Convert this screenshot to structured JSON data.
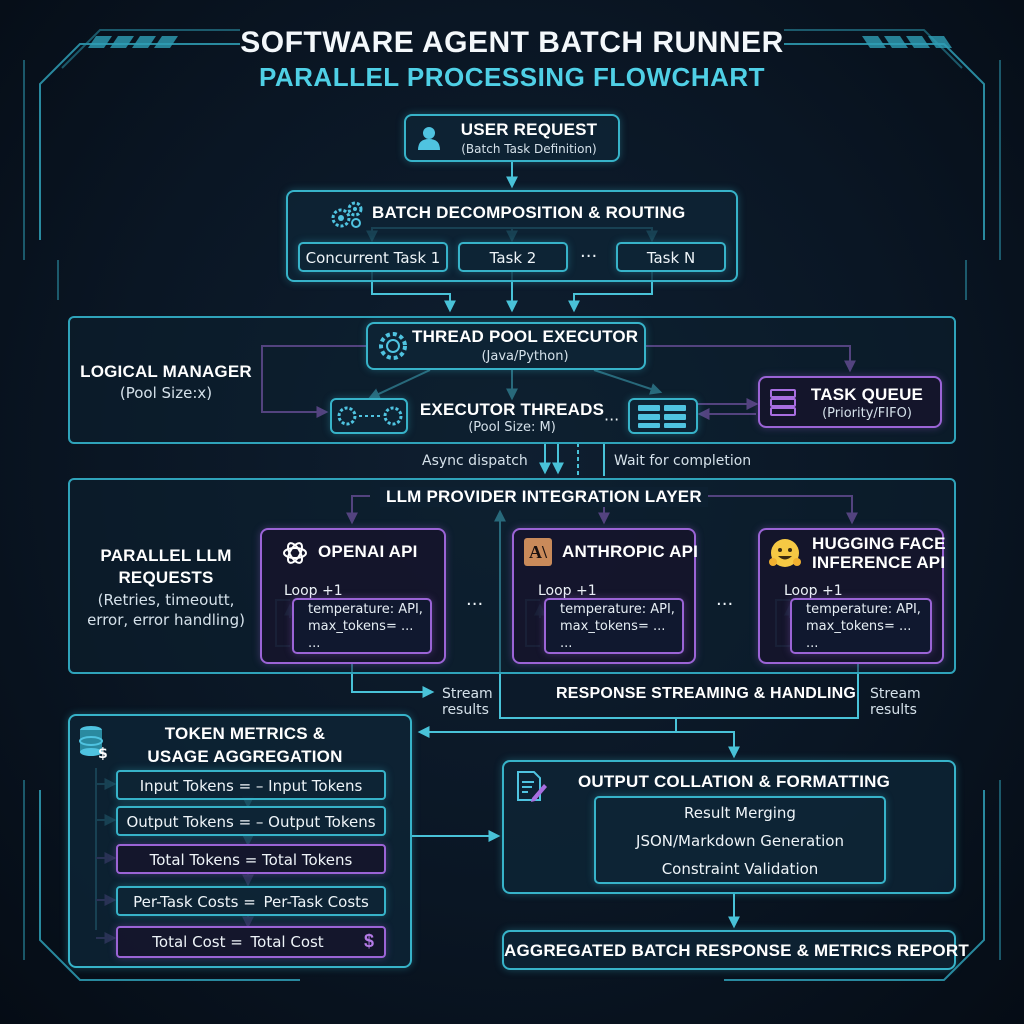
{
  "header": {
    "title": "SOFTWARE AGENT BATCH RUNNER",
    "subtitle": "PARALLEL PROCESSING FLOWCHART"
  },
  "user_request": {
    "title": "USER REQUEST",
    "sub": "(Batch Task Definition)",
    "icon": "user-icon"
  },
  "batch": {
    "title": "BATCH DECOMPOSITION & ROUTING",
    "icon": "gears-icon",
    "tasks": [
      "Concurrent Task 1",
      "Task 2",
      "Task N"
    ],
    "ellipsis": "···"
  },
  "manager": {
    "label": "LOGICAL MANAGER",
    "pool": "(Pool Size:x)",
    "executor_title": "THREAD POOL EXECUTOR",
    "executor_sub": "(Java/Python)",
    "threads_title": "EXECUTOR THREADS",
    "threads_sub": "(Pool Size: M)",
    "threads_ellipsis": "···",
    "queue_title": "TASK QUEUE",
    "queue_sub": "(Priority/FIFO)",
    "async_label": "Async dispatch",
    "wait_label": "Wait for completion"
  },
  "llm": {
    "layer_title": "LLM PROVIDER INTEGRATION LAYER",
    "left_title": "PARALLEL LLM\nREQUESTS",
    "left_sub": "(Retries, timeoutt,\nerror, error handling)",
    "ellipsis": "···",
    "providers": [
      {
        "name": "OPENAI API",
        "icon": "openai-icon",
        "loop": "Loop +1",
        "code": "temperature: API,\nmax_tokens= ...\n..."
      },
      {
        "name": "ANTHROPIC API",
        "icon": "anthropic-icon",
        "icon_text": "A\\",
        "loop": "Loop +1",
        "code": "temperature: API,\nmax_tokens= ...\n..."
      },
      {
        "name": "HUGGING FACE\nINFERENCE API",
        "icon": "hugging-face-icon",
        "loop": "Loop +1",
        "code": "temperature: API,\nmax_tokens= ...\n..."
      }
    ],
    "stream_left": "Stream\nresults",
    "stream_right": "Stream\nresults",
    "response_title": "RESPONSE STREAMING & HANDLING"
  },
  "metrics": {
    "title": "TOKEN METRICS &\nUSAGE AGGREGATION",
    "icon": "database-dollar-icon",
    "rows": [
      "Input Tokens = – Input Tokens",
      "Output Tokens = – Output Tokens",
      "Total Tokens = Total Tokens",
      "Per-Task Costs =  Per-Task Costs",
      "Total Cost =  Total Cost"
    ],
    "cost_symbol": "$"
  },
  "output": {
    "title": "OUTPUT COLLATION & FORMATTING",
    "icon": "document-edit-icon",
    "items": [
      "Result Merging",
      "JSON/Markdown Generation",
      "Constraint Validation"
    ]
  },
  "final": {
    "title": "AGGREGATED BATCH RESPONSE & METRICS REPORT"
  },
  "colors": {
    "cyan": "#37b3c9",
    "purple": "#9b64d6",
    "background": "#0a1624"
  }
}
